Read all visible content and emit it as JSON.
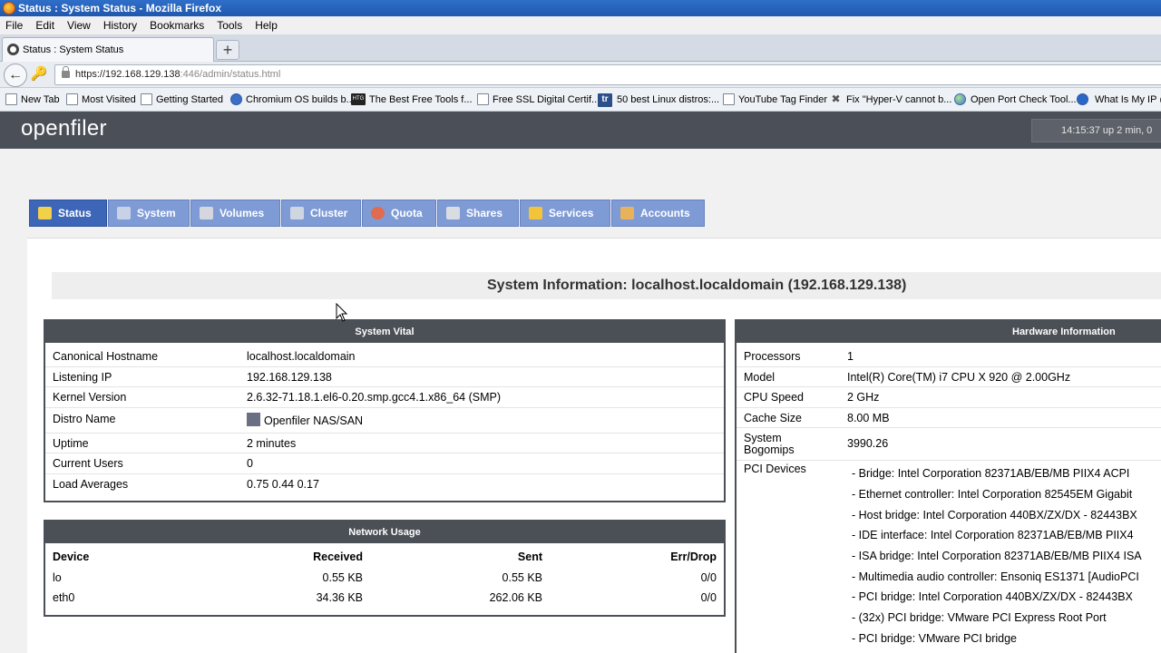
{
  "window": {
    "title": "Status : System Status - Mozilla Firefox"
  },
  "menu": [
    "File",
    "Edit",
    "View",
    "History",
    "Bookmarks",
    "Tools",
    "Help"
  ],
  "browser_tab": {
    "title": "Status : System Status",
    "new_tab_symbol": "+"
  },
  "url": {
    "host": "https://192.168.129.138",
    "rest": ":446/admin/status.html"
  },
  "bookmarks": [
    "New Tab",
    "Most Visited",
    "Getting Started",
    "Chromium OS builds b...",
    "The Best Free Tools f...",
    "Free SSL Digital Certif...",
    "50 best Linux distros:...",
    "YouTube Tag Finder",
    "Fix \"Hyper-V cannot b...",
    "Open Port Check Tool...",
    "What Is My IP @"
  ],
  "bookmark_icon_text": {
    "htg": "HTG",
    "tr": "tr"
  },
  "header": {
    "logo": "openfiler",
    "uptime": "14:15:37 up 2 min, 0"
  },
  "nav_tabs": [
    "Status",
    "System",
    "Volumes",
    "Cluster",
    "Quota",
    "Shares",
    "Services",
    "Accounts"
  ],
  "system_info_title": "System Information: localhost.localdomain (192.168.129.138)",
  "vital": {
    "title": "System Vital",
    "rows": [
      {
        "k": "Canonical Hostname",
        "v": "localhost.localdomain"
      },
      {
        "k": "Listening IP",
        "v": "192.168.129.138"
      },
      {
        "k": "Kernel Version",
        "v": "2.6.32-71.18.1.el6-0.20.smp.gcc4.1.x86_64 (SMP)"
      },
      {
        "k": "Distro Name",
        "v": "Openfiler NAS/SAN"
      },
      {
        "k": "Uptime",
        "v": "2 minutes"
      },
      {
        "k": "Current Users",
        "v": "0"
      },
      {
        "k": "Load Averages",
        "v": "0.75 0.44 0.17"
      }
    ]
  },
  "network": {
    "title": "Network Usage",
    "headers": [
      "Device",
      "Received",
      "Sent",
      "Err/Drop"
    ],
    "rows": [
      [
        "lo",
        "0.55 KB",
        "0.55 KB",
        "0/0"
      ],
      [
        "eth0",
        "34.36 KB",
        "262.06 KB",
        "0/0"
      ]
    ]
  },
  "hardware": {
    "title": "Hardware Information",
    "rows": [
      {
        "k": "Processors",
        "v": "1"
      },
      {
        "k": "Model",
        "v": "Intel(R) Core(TM) i7 CPU X 920 @ 2.00GHz"
      },
      {
        "k": "CPU Speed",
        "v": "2 GHz"
      },
      {
        "k": "Cache Size",
        "v": "8.00 MB"
      },
      {
        "k": "System Bogomips",
        "k1": "System",
        "k2": "Bogomips",
        "v": "3990.26"
      }
    ],
    "pci_label": "PCI Devices",
    "pci_devices": [
      "-  Bridge: Intel Corporation 82371AB/EB/MB PIIX4 ACPI",
      "-  Ethernet controller: Intel Corporation 82545EM Gigabit",
      "-  Host bridge: Intel Corporation 440BX/ZX/DX - 82443BX",
      "-  IDE interface: Intel Corporation 82371AB/EB/MB PIIX4",
      "-  ISA bridge: Intel Corporation 82371AB/EB/MB PIIX4 ISA",
      "-  Multimedia audio controller: Ensoniq ES1371 [AudioPCI",
      "-  PCI bridge: Intel Corporation 440BX/ZX/DX - 82443BX",
      "-  (32x) PCI bridge: VMware PCI Express Root Port",
      "-  PCI bridge: VMware PCI bridge"
    ]
  },
  "colors": {
    "header_bg": "#4b5058",
    "tab_bg": "#7f9bd6",
    "tab_active_bg": "#3d66b8",
    "box_border": "#4b4f56"
  }
}
